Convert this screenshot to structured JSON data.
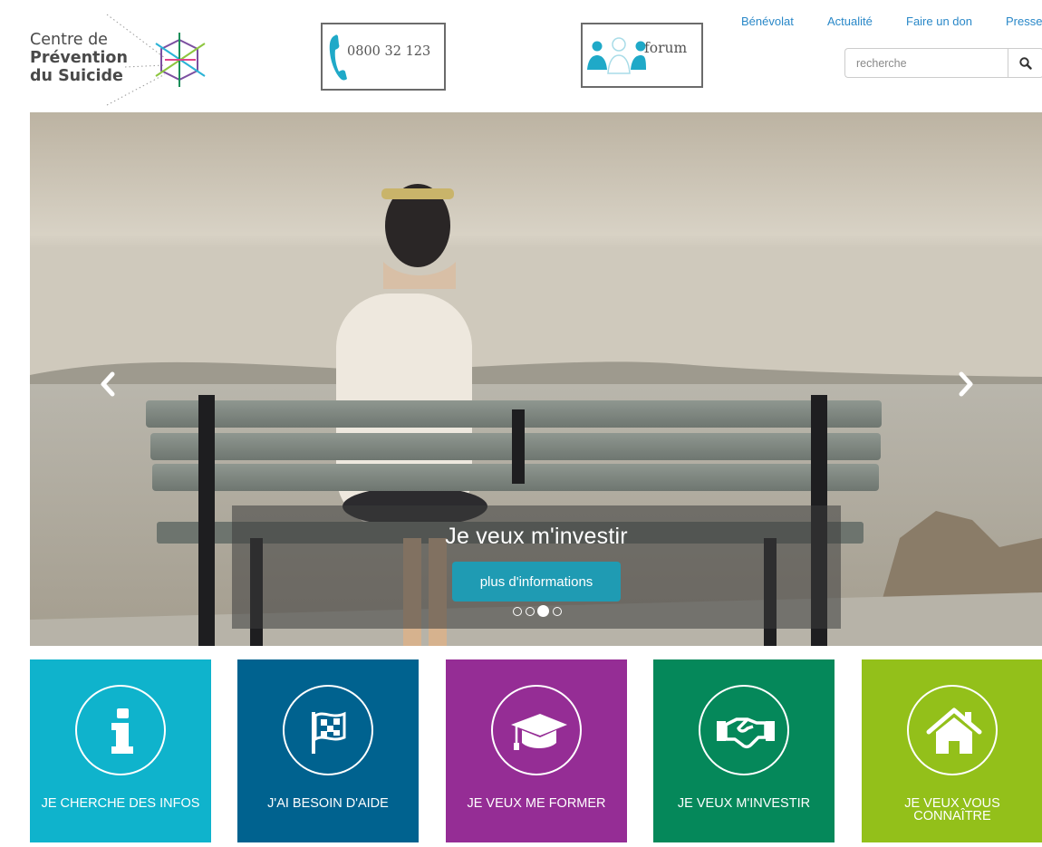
{
  "logo": {
    "line1": "Centre de",
    "line2": "Prévention",
    "line3": "du Suicide"
  },
  "phone": {
    "number": "0800 32 123",
    "icon": "phone-icon"
  },
  "forum": {
    "label": "forum",
    "icon": "people-icon"
  },
  "nav": {
    "items": [
      "Bénévolat",
      "Actualité",
      "Faire un don",
      "Presse"
    ]
  },
  "search": {
    "placeholder": "recherche",
    "icon": "search-icon"
  },
  "hero": {
    "caption": "Je veux m'investir",
    "button": "plus d'informations",
    "slide_count": 4,
    "active_slide": 3
  },
  "tiles": [
    {
      "label": "JE CHERCHE DES INFOS",
      "color": "#0fb3cc",
      "icon": "info-icon"
    },
    {
      "label": "J'AI BESOIN D'AIDE",
      "color": "#00628f",
      "icon": "flag-icon"
    },
    {
      "label": "JE VEUX ME FORMER",
      "color": "#952d95",
      "icon": "graduation-cap-icon"
    },
    {
      "label": "JE VEUX M'INVESTIR",
      "color": "#05885a",
      "icon": "handshake-icon"
    },
    {
      "label": "JE VEUX VOUS CONNAÎTRE",
      "color": "#93c01a",
      "icon": "home-icon"
    }
  ],
  "colors": {
    "link": "#2a88c8",
    "accent_button": "#1f9bb3"
  }
}
